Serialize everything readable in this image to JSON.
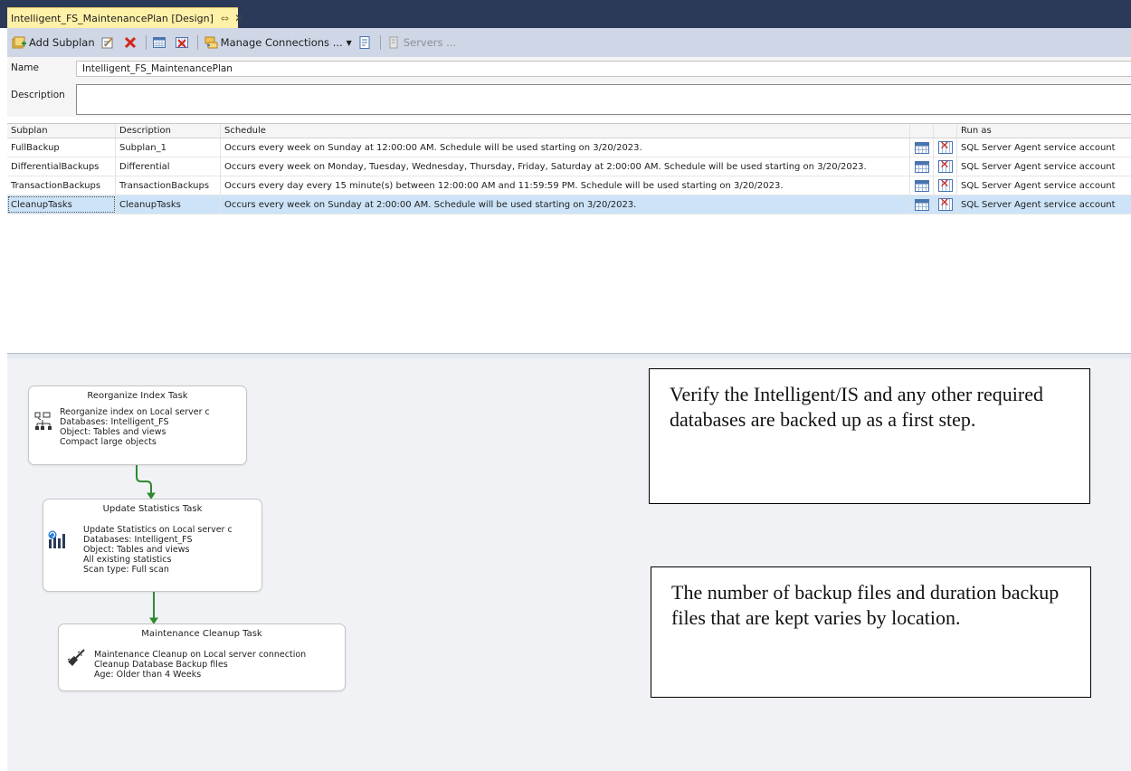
{
  "document_tab": {
    "title": "Intelligent_FS_MaintenancePlan [Design]",
    "pin_glyph": "⇔",
    "close_glyph": "✕"
  },
  "toolbar": {
    "add_subplan": "Add Subplan",
    "manage_connections": "Manage Connections ...",
    "servers": "Servers ..."
  },
  "properties": {
    "name_label": "Name",
    "name_value": "Intelligent_FS_MaintenancePlan",
    "description_label": "Description",
    "description_value": ""
  },
  "grid": {
    "headers": {
      "subplan": "Subplan",
      "description": "Description",
      "schedule": "Schedule",
      "run_as": "Run as"
    },
    "rows": [
      {
        "subplan": "FullBackup",
        "description": "Subplan_1",
        "schedule": "Occurs every week on Sunday at 12:00:00 AM. Schedule will be used starting on 3/20/2023.",
        "run_as": "SQL Server Agent service account"
      },
      {
        "subplan": "DifferentialBackups",
        "description": "Differential",
        "schedule": "Occurs every week on Monday, Tuesday, Wednesday, Thursday, Friday, Saturday at 2:00:00 AM. Schedule will be used starting on 3/20/2023.",
        "run_as": "SQL Server Agent service account"
      },
      {
        "subplan": "TransactionBackups",
        "description": "TransactionBackups",
        "schedule": "Occurs every day every 15 minute(s) between 12:00:00 AM and 11:59:59 PM. Schedule will be used starting on 3/20/2023.",
        "run_as": "SQL Server Agent service account"
      },
      {
        "subplan": "CleanupTasks",
        "description": "CleanupTasks",
        "schedule": "Occurs every week on Sunday at 2:00:00 AM. Schedule will be used starting on 3/20/2023.",
        "run_as": "SQL Server Agent service account"
      }
    ],
    "selected_row": 3
  },
  "tasks": {
    "reorganize": {
      "title": "Reorganize Index Task",
      "lines": [
        "Reorganize index on Local server c",
        "Databases: Intelligent_FS",
        "Object: Tables and views",
        "Compact large objects"
      ]
    },
    "update_stats": {
      "title": "Update Statistics Task",
      "lines": [
        "Update Statistics on Local server c",
        "Databases: Intelligent_FS",
        "Object: Tables and views",
        "All existing statistics",
        "Scan type: Full scan"
      ]
    },
    "cleanup": {
      "title": "Maintenance Cleanup Task",
      "lines": [
        "Maintenance Cleanup on Local server connection",
        "Cleanup Database Backup files",
        "Age: Older than 4 Weeks"
      ]
    }
  },
  "notes": {
    "note1": "Verify the Intelligent/IS and any other required databases are backed up as a first step.",
    "note2": "The number of backup files and duration backup files that are kept varies by location."
  },
  "colors": {
    "tab_strip": "#2b3a58",
    "active_tab": "#fff1a8",
    "toolbar": "#cfd6e5",
    "selected_row": "#cce3f8",
    "precedence_arrow": "#2f8a2f"
  }
}
